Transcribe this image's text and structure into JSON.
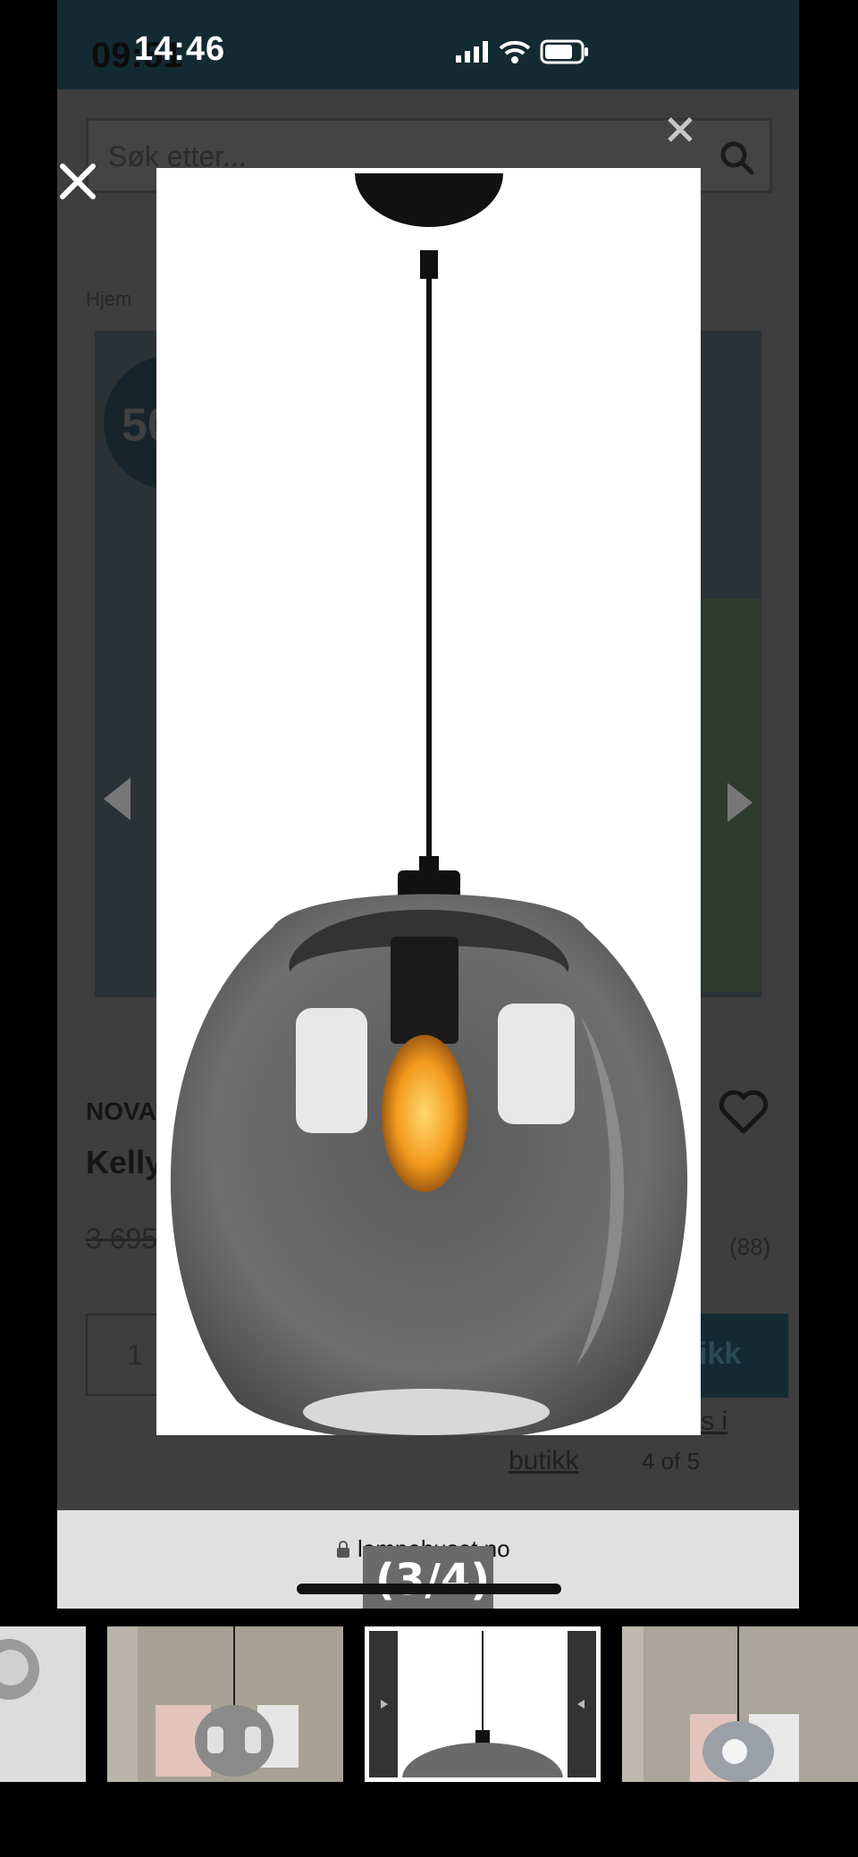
{
  "viewer": {
    "time": "14:46",
    "close_icon": "close-icon",
    "page_counter": "(3/4)"
  },
  "screenshot": {
    "time": "09:51",
    "search_placeholder": "Søk etter...",
    "breadcrumb": "Hjem",
    "discount_partial": "50",
    "brand_partial": "NOVA",
    "title_partial": "Kelly",
    "old_price_partial": "3 695",
    "reviews_count": "(88)",
    "quantity": "1",
    "buy_label_partial": "ikk",
    "store_link_partial": "s i",
    "store_link_line2": "butikk",
    "image_counter": "4 of 5",
    "url": "lampehuset.no"
  },
  "thumbnails": [
    {
      "id": "thumb-1",
      "kind": "lamp-closeup"
    },
    {
      "id": "thumb-2",
      "kind": "room-lamp"
    },
    {
      "id": "thumb-3",
      "kind": "current-screenshot"
    },
    {
      "id": "thumb-4",
      "kind": "room-lamp-lit"
    }
  ],
  "colors": {
    "dark_teal": "#142a33",
    "overlay": "#3e3e3e"
  }
}
